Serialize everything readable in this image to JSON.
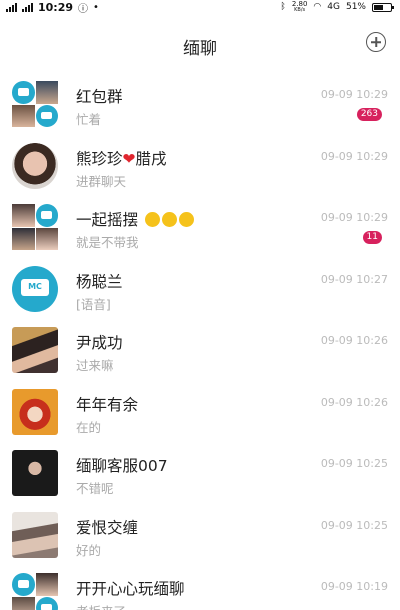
{
  "status_bar": {
    "time": "10:29",
    "net_speed": "2.80",
    "speed_unit": "KB/s",
    "network": "4G",
    "battery": "51%"
  },
  "header": {
    "title": "缅聊"
  },
  "chats": [
    {
      "name": "红包群",
      "preview": "忙着",
      "time": "09-09 10:29",
      "badge": "263",
      "avatar": "group"
    },
    {
      "name": "熊珍珍",
      "name_suffix": "腊戌",
      "preview": "进群聊天",
      "time": "09-09 10:29",
      "badge": null,
      "avatar": "photo"
    },
    {
      "name": "一起摇摆",
      "preview": "就是不带我",
      "time": "09-09 10:29",
      "badge": "11",
      "avatar": "group"
    },
    {
      "name": "杨聪兰",
      "preview": "[语音]",
      "time": "09-09 10:27",
      "badge": null,
      "avatar": "logo"
    },
    {
      "name": "尹成功",
      "preview": "过来嘛",
      "time": "09-09 10:26",
      "badge": null,
      "avatar": "photo"
    },
    {
      "name": "年年有余",
      "preview": "在的",
      "time": "09-09 10:26",
      "badge": null,
      "avatar": "photo"
    },
    {
      "name": "缅聊客服007",
      "preview": "不错呢",
      "time": "09-09 10:25",
      "badge": null,
      "avatar": "photo"
    },
    {
      "name": "爱恨交缠",
      "preview": "好的",
      "time": "09-09 10:25",
      "badge": null,
      "avatar": "photo"
    },
    {
      "name": "开开心心玩缅聊",
      "preview": "老板来了",
      "time": "09-09 10:19",
      "badge": null,
      "avatar": "group"
    }
  ],
  "colors": {
    "accent_badge": "#d7215d",
    "logo_blue": "#25a9cc",
    "time_gray": "#bbbbbb",
    "preview_gray": "#aaaaaa"
  },
  "icons": {
    "add": "plus-circle-icon",
    "heart": "heart-icon",
    "emoji": "laughing-emoji-icon"
  }
}
